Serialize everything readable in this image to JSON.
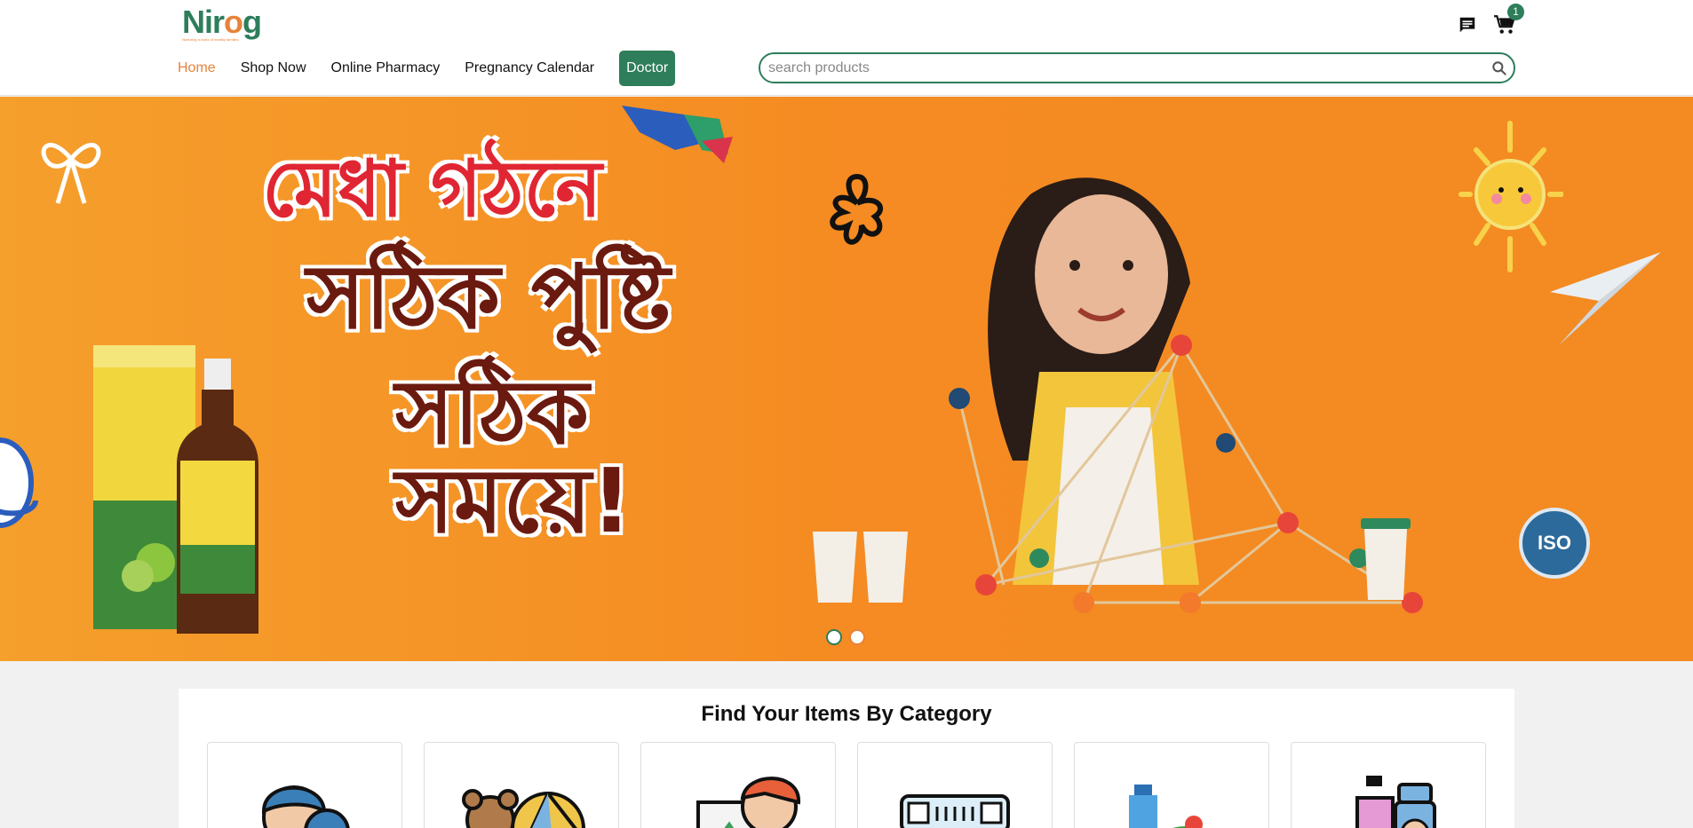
{
  "header": {
    "logo": {
      "name": "Nirog",
      "tagline": "Nurturing a world of healthy families"
    },
    "nav": [
      {
        "label": "Home",
        "active": true
      },
      {
        "label": "Shop Now"
      },
      {
        "label": "Online Pharmacy"
      },
      {
        "label": "Pregnancy Calendar"
      },
      {
        "label": "Doctor"
      }
    ],
    "search": {
      "placeholder": "search products",
      "value": ""
    },
    "cart": {
      "count": "1"
    },
    "icons": {
      "chat": "chat-icon",
      "cart": "cart-icon",
      "search": "search-icon"
    }
  },
  "banner": {
    "headline_line1": "মেধা গঠনে",
    "headline_line2": "সঠিক পুষ্টি",
    "headline_line3": "সঠিক সময়ে!",
    "iso_label": "ISO",
    "slide_count": 2,
    "active_slide": 0
  },
  "category_section": {
    "title": "Find Your Items By Category",
    "cards": [
      {
        "icon": "mother-child-icon"
      },
      {
        "icon": "baby-toys-icon"
      },
      {
        "icon": "kids-learning-icon"
      },
      {
        "icon": "diaper-icon"
      },
      {
        "icon": "food-nutrition-icon"
      },
      {
        "icon": "baby-care-icon"
      }
    ]
  },
  "colors": {
    "brand_green": "#2e7d5b",
    "brand_orange": "#e8823a",
    "banner_orange": "#f58b22"
  }
}
